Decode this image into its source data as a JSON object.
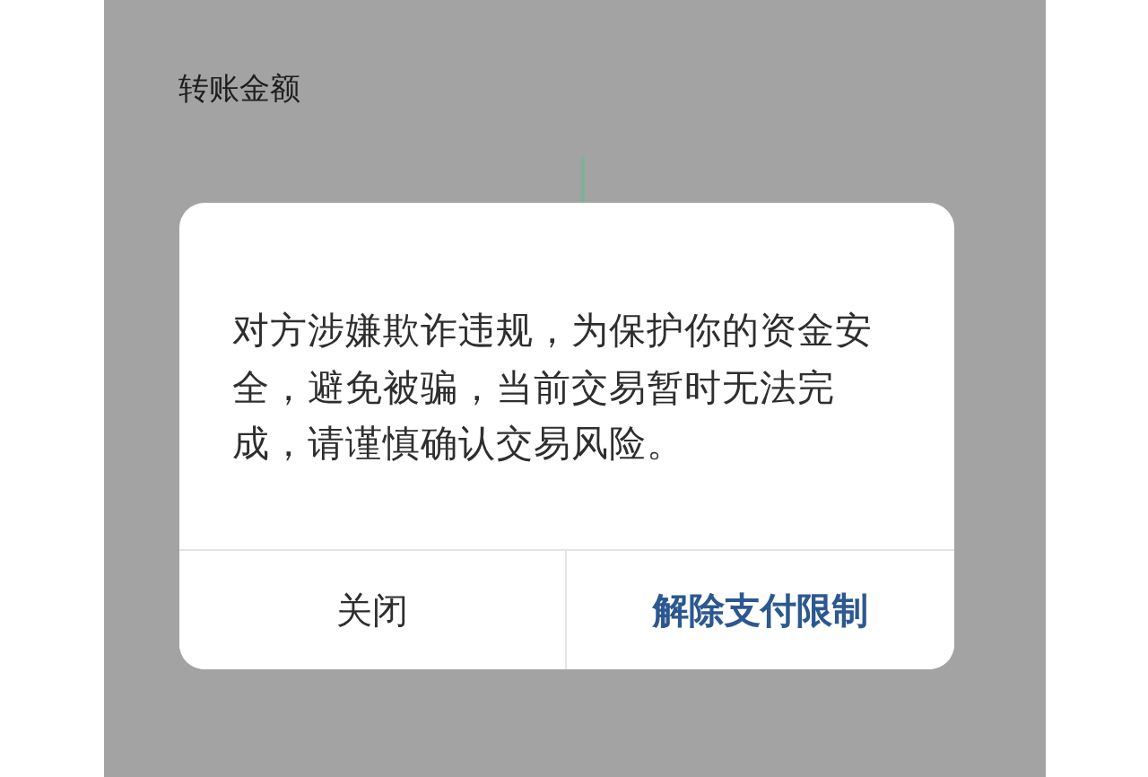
{
  "screen": {
    "label": "转账金额"
  },
  "dialog": {
    "message": "对方涉嫌欺诈违规，为保护你的资金安全，避免被骗，当前交易暂时无法完成，请谨慎确认交易风险。",
    "buttons": [
      {
        "label": "关闭",
        "kind": "secondary"
      },
      {
        "label": "解除支付限制",
        "kind": "primary"
      }
    ]
  }
}
